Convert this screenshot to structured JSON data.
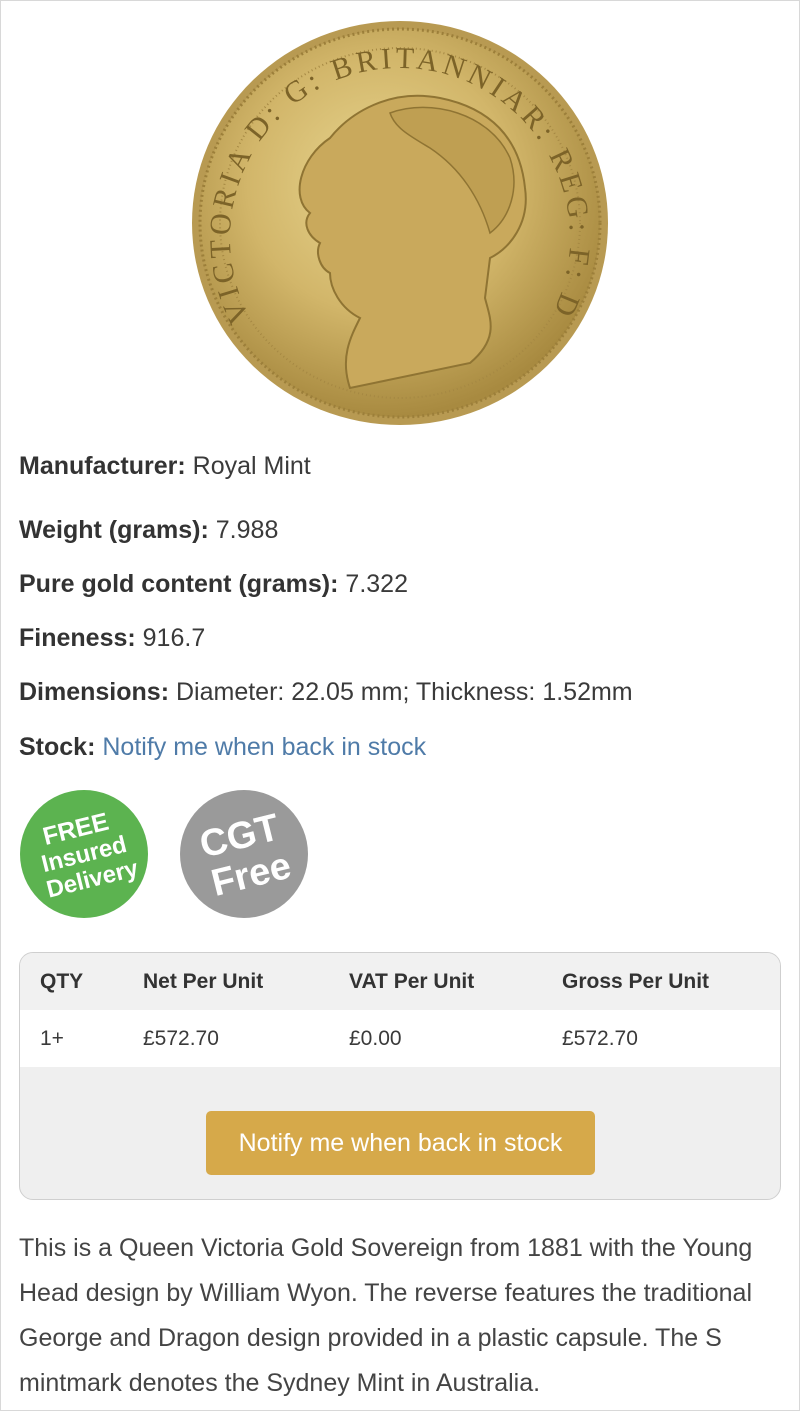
{
  "product": {
    "image_alt": "Queen Victoria Young Head gold sovereign coin",
    "coin_legend": "VICTORIA D: G: BRITANNIAR: REG: F: D:",
    "specs": [
      {
        "label": "Manufacturer:",
        "value": "Royal Mint"
      },
      {
        "label": "Weight (grams):",
        "value": "7.988"
      },
      {
        "label": "Pure gold content (grams):",
        "value": "7.322"
      },
      {
        "label": "Fineness:",
        "value": "916.7"
      },
      {
        "label": "Dimensions:",
        "value": "Diameter: 22.05 mm; Thickness: 1.52mm"
      },
      {
        "label": "Stock:",
        "value": "Notify me when back in stock"
      }
    ]
  },
  "badges": {
    "free_delivery": {
      "lines": [
        "FREE",
        "Insured",
        "Delivery"
      ],
      "color": "#5cb350"
    },
    "cgt": {
      "lines": [
        "CGT",
        "Free"
      ],
      "color": "#9a9a9a"
    }
  },
  "price_table": {
    "headers": [
      "QTY",
      "Net Per Unit",
      "VAT Per Unit",
      "Gross Per Unit"
    ],
    "rows": [
      [
        "1+",
        "£572.70",
        "£0.00",
        "£572.70"
      ]
    ],
    "notify_button": "Notify me when back in stock",
    "button_color": "#d6a94a"
  },
  "description": "This is a Queen Victoria Gold Sovereign from 1881 with the Young Head design by William Wyon. The reverse features the traditional George and Dragon design provided in a plastic capsule. The S mintmark denotes the Sydney Mint in Australia."
}
